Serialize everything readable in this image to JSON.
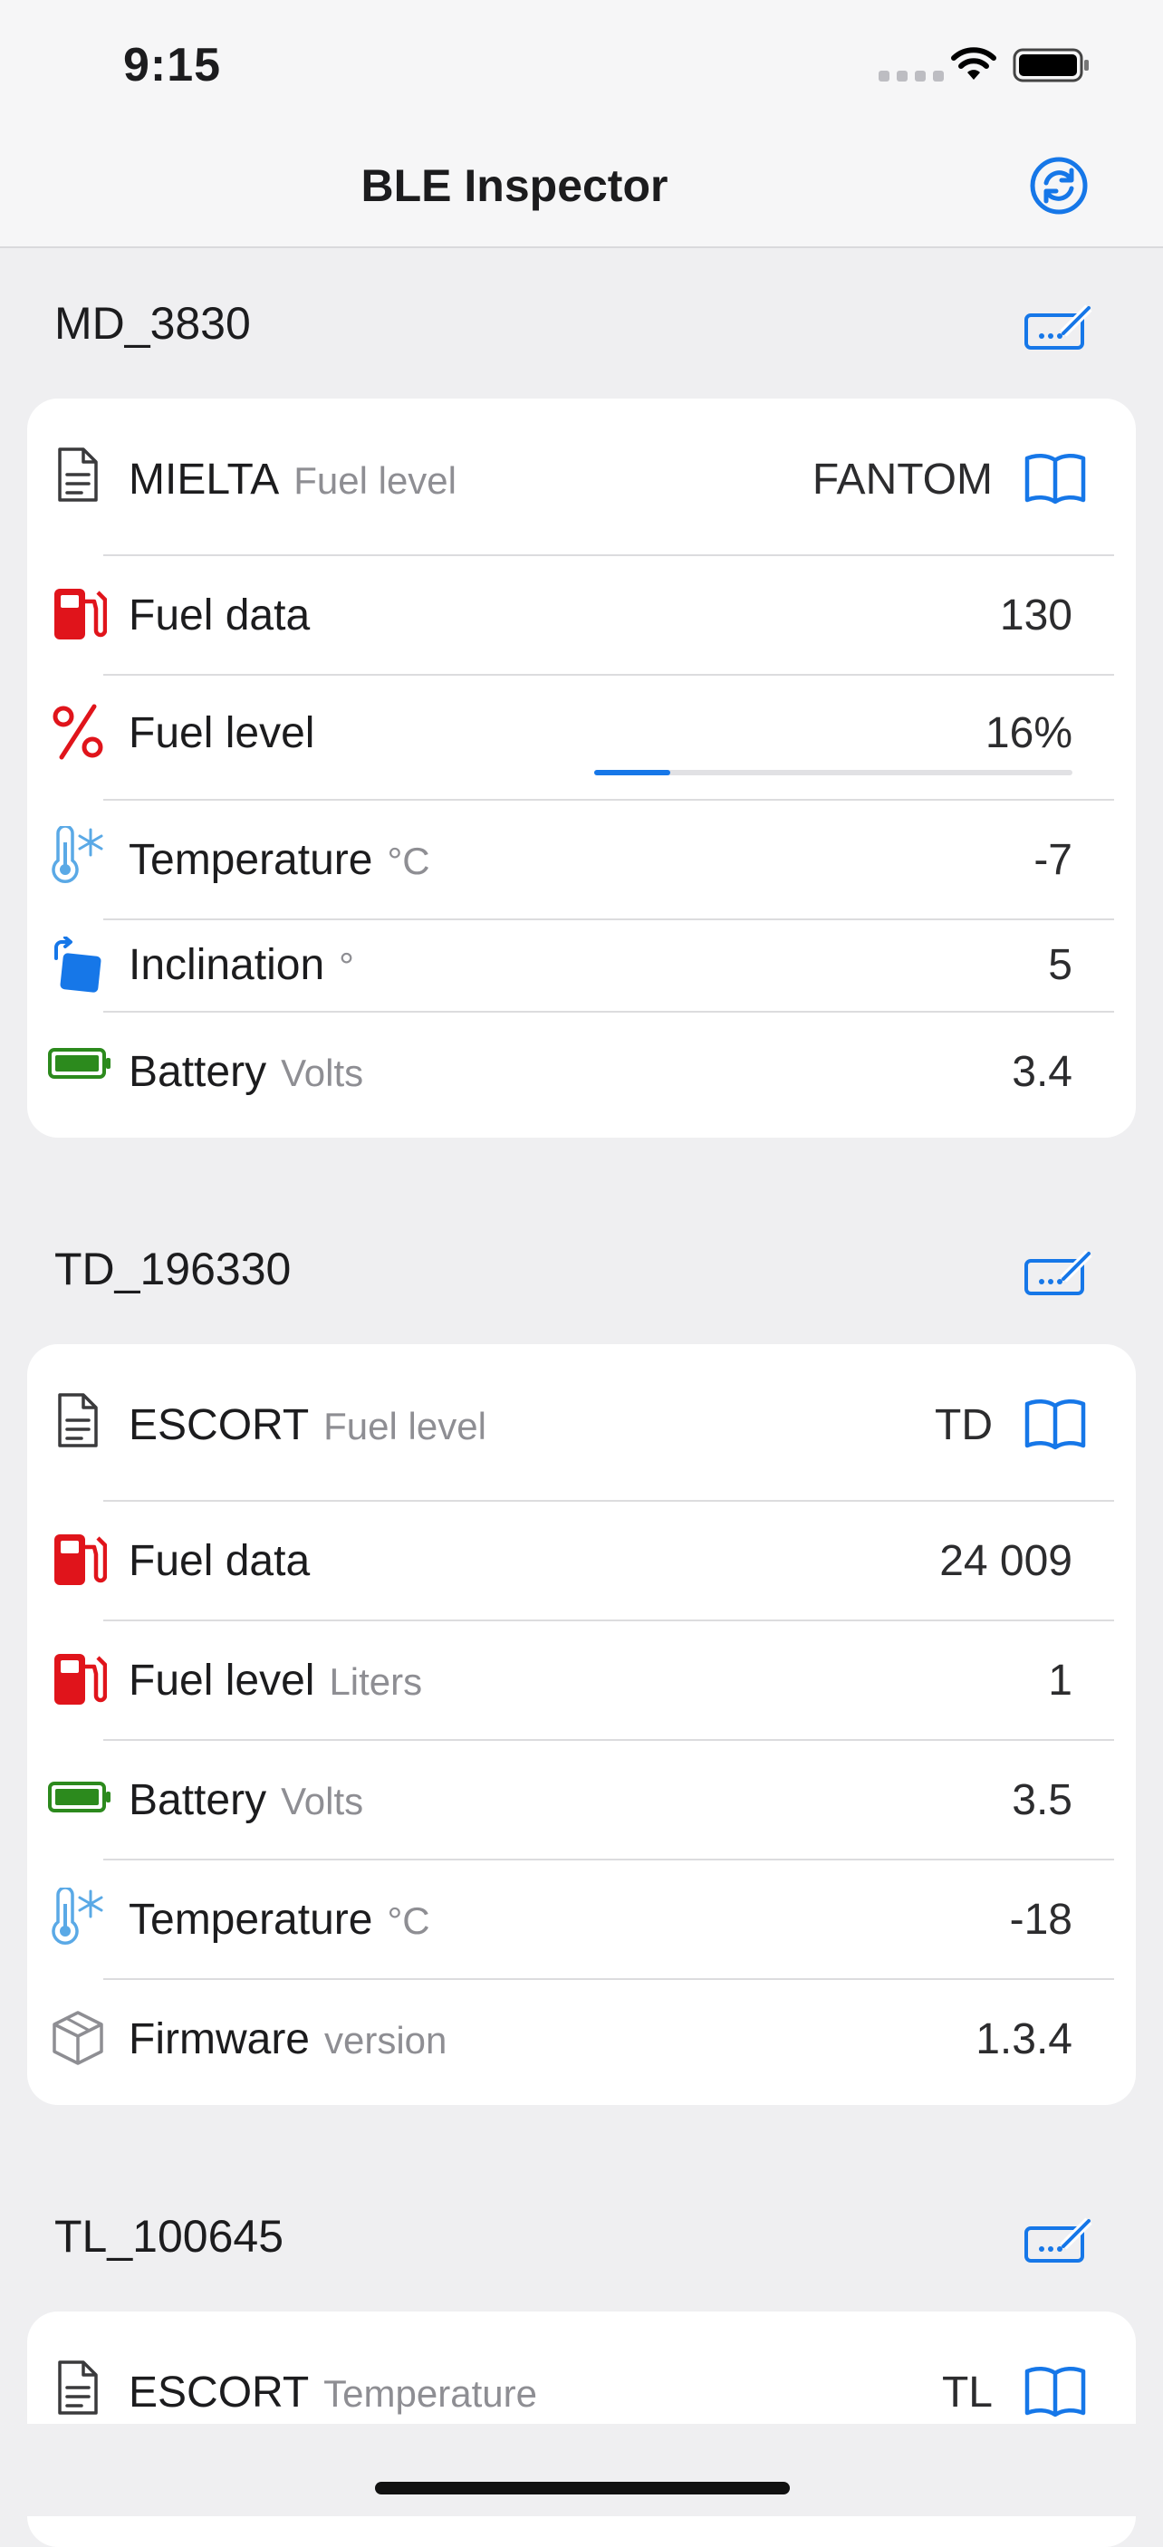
{
  "status_bar": {
    "time": "9:15"
  },
  "nav": {
    "title": "BLE Inspector"
  },
  "colors": {
    "accent": "#1677e8",
    "fuel_red": "#e0141b",
    "battery_green": "#2c8a1d",
    "temp_blue": "#5aa9e6"
  },
  "sections": [
    {
      "header": "MD_3830",
      "device": {
        "name": "MIELTA",
        "subtitle": "Fuel level",
        "model": "FANTOM"
      },
      "rows": [
        {
          "icon": "fuel-pump-icon",
          "label": "Fuel data",
          "unit": "",
          "value": "130"
        },
        {
          "icon": "percent-icon",
          "label": "Fuel level",
          "unit": "",
          "value": "16%",
          "progress": 0.16
        },
        {
          "icon": "thermometer-snow-icon",
          "label": "Temperature",
          "unit": "°C",
          "value": "-7"
        },
        {
          "icon": "rotate-square-icon",
          "label": "Inclination",
          "unit": "°",
          "value": "5"
        },
        {
          "icon": "battery-icon",
          "label": "Battery",
          "unit": "Volts",
          "value": "3.4"
        }
      ]
    },
    {
      "header": "TD_196330",
      "device": {
        "name": "ESCORT",
        "subtitle": "Fuel level",
        "model": "TD"
      },
      "rows": [
        {
          "icon": "fuel-pump-icon",
          "label": "Fuel data",
          "unit": "",
          "value": "24 009"
        },
        {
          "icon": "fuel-pump-icon",
          "label": "Fuel level",
          "unit": "Liters",
          "value": "1"
        },
        {
          "icon": "battery-icon",
          "label": "Battery",
          "unit": "Volts",
          "value": "3.5"
        },
        {
          "icon": "thermometer-snow-icon",
          "label": "Temperature",
          "unit": "°C",
          "value": "-18"
        },
        {
          "icon": "cube-icon",
          "label": "Firmware",
          "unit": "version",
          "value": "1.3.4"
        }
      ]
    },
    {
      "header": "TL_100645",
      "device": {
        "name": "ESCORT",
        "subtitle": "Temperature",
        "model": "TL"
      },
      "rows": []
    }
  ]
}
